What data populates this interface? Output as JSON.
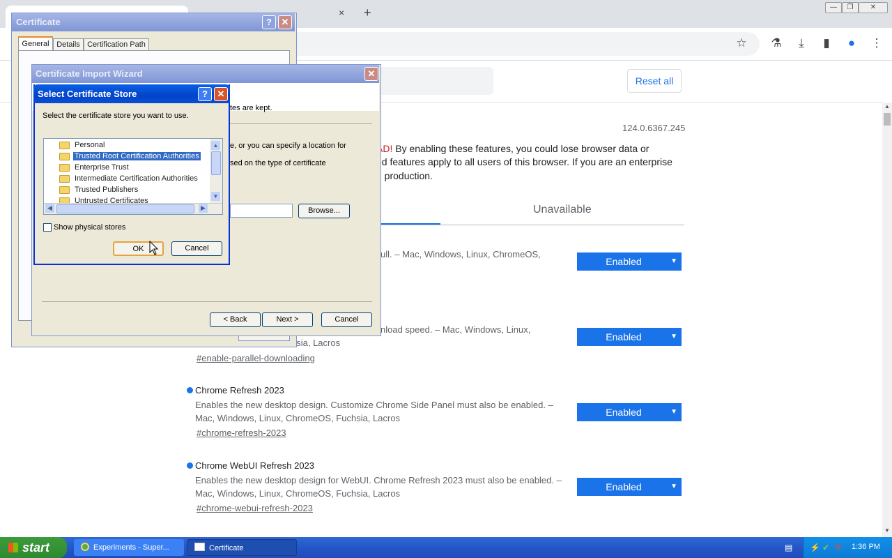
{
  "browser": {
    "tab_close": "×",
    "new_tab": "+",
    "win_min": "—",
    "win_restore": "❐",
    "win_close": "✕",
    "icons": [
      "star-icon",
      "flask-icon",
      "download-icon",
      "side-panel-icon",
      "profile-icon",
      "menu-icon"
    ]
  },
  "flags_page": {
    "reset_all": "Reset all",
    "version": "124.0.6367.245",
    "warning_red": "AD!",
    "warning_line1": " By enabling these features, you could lose browser data or",
    "warning_line2": "ed features apply to all users of this browser. If you are an enterprise",
    "warning_line3": "n production.",
    "tab_unavailable": "Unavailable",
    "flags": [
      {
        "desc1": "ull. – Mac, Windows, Linux, ChromeOS,",
        "desc2": "",
        "link": "",
        "state": "Enabled"
      },
      {
        "desc1": "nload speed. – Mac, Windows, Linux,",
        "desc2": "hsia, Lacros",
        "link": "#enable-parallel-downloading",
        "state": "Enabled"
      },
      {
        "title": "Chrome Refresh 2023",
        "desc1": "Enables the new desktop design. Customize Chrome Side Panel must also be enabled. –",
        "desc2": "Mac, Windows, Linux, ChromeOS, Fuchsia, Lacros",
        "link": "#chrome-refresh-2023",
        "state": "Enabled"
      },
      {
        "title": "Chrome WebUI Refresh 2023",
        "desc1": "Enables the new desktop design for WebUI. Chrome Refresh 2023 must also be enabled. –",
        "desc2": "Mac, Windows, Linux, ChromeOS, Fuchsia, Lacros",
        "link": "#chrome-webui-refresh-2023",
        "state": "Enabled"
      }
    ]
  },
  "certificate_dialog": {
    "title": "Certificate",
    "tabs": [
      "General",
      "Details",
      "Certification Path"
    ]
  },
  "import_wizard": {
    "title": "Certificate Import Wizard",
    "text1": "tes are kept.",
    "text2": "e, or you can specify a location for",
    "text3": "sed on the type of certificate",
    "browse": "Browse...",
    "back": "< Back",
    "next": "Next >",
    "cancel": "Cancel"
  },
  "store_dialog": {
    "title": "Select Certificate Store",
    "prompt": "Select the certificate store you want to use.",
    "stores": [
      "Personal",
      "Trusted Root Certification Authorities",
      "Enterprise Trust",
      "Intermediate Certification Authorities",
      "Trusted Publishers",
      "Untrusted Certificates"
    ],
    "selected_index": 1,
    "show_physical": "Show physical stores",
    "ok": "OK",
    "cancel": "Cancel"
  },
  "taskbar": {
    "start": "start",
    "tasks": [
      "Experiments - Super...",
      "Certificate"
    ],
    "clock": "1:36 PM"
  }
}
